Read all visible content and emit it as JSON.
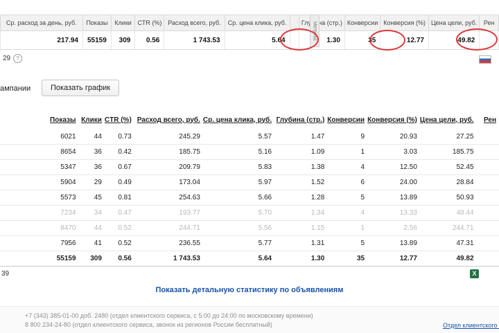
{
  "accent": {
    "annotation_red": "#e03636",
    "link_blue": "#1552ac",
    "excel_green": "#217346"
  },
  "summary": {
    "columns": [
      "Ср. расход за день, руб.",
      "Показы",
      "Клики",
      "CTR (%)",
      "Расход всего, руб.",
      "Ср. цена клика, руб.",
      "Глубина (стр.)",
      "Конверсии",
      "Конверсия (%)",
      "Цена цели, руб.",
      "Рен"
    ],
    "values": [
      "217.94",
      "55159",
      "309",
      "0.56",
      "1 743.53",
      "5.64",
      "1.30",
      "35",
      "12.77",
      "49.82"
    ]
  },
  "metrika_tab": {
    "label": "Метрика"
  },
  "meta": {
    "count": "29",
    "help": "?"
  },
  "toolbar": {
    "campaigns_text": "ампании",
    "show_chart": "Показать график"
  },
  "table": {
    "columns": [
      "Показы",
      "Клики",
      "CTR (%)",
      "Расход всего, руб.",
      "Ср. цена клика, руб.",
      "Глубина (стр.)",
      "Конверсии",
      "Конверсия (%)",
      "Цена цели, руб.",
      "Рен"
    ],
    "rows": [
      [
        "6021",
        "44",
        "0.73",
        "245.29",
        "5.57",
        "1.47",
        "9",
        "20.93",
        "27.25"
      ],
      [
        "8654",
        "36",
        "0.42",
        "185.75",
        "5.16",
        "1.09",
        "1",
        "3.03",
        "185.75"
      ],
      [
        "5347",
        "36",
        "0.67",
        "209.79",
        "5.83",
        "1.38",
        "4",
        "12.50",
        "52.45"
      ],
      [
        "5904",
        "29",
        "0.49",
        "173.04",
        "5.97",
        "1.52",
        "6",
        "24.00",
        "28.84"
      ],
      [
        "5573",
        "45",
        "0.81",
        "254.63",
        "5.66",
        "1.28",
        "5",
        "13.89",
        "50.93"
      ],
      [
        "7234",
        "34",
        "0.47",
        "193.77",
        "5.70",
        "1.34",
        "4",
        "13.33",
        "48.44"
      ],
      [
        "8470",
        "44",
        "0.52",
        "244.71",
        "5.56",
        "1.15",
        "1",
        "2.56",
        "244.71"
      ],
      [
        "7956",
        "41",
        "0.52",
        "236.55",
        "5.77",
        "1.31",
        "5",
        "13.89",
        "47.31"
      ]
    ],
    "total": [
      "55159",
      "309",
      "0.56",
      "1 743.53",
      "5.64",
      "1.30",
      "35",
      "12.77",
      "49.82"
    ]
  },
  "below": {
    "count": "39",
    "excel_glyph": "X"
  },
  "links": {
    "details": "Показать детальную статистику по объявлениям",
    "support": "Отдел клиентского сервиса"
  },
  "footer": {
    "line1": "+7 (343) 385-01-00 доб. 2480 (отдел клиентского сервиса, с 5:00 до 24:00 по московскому времени)",
    "line2": "8 800 234-24-80 (отдел клиентского сервиса, звонок из регионов России бесплатный)"
  }
}
